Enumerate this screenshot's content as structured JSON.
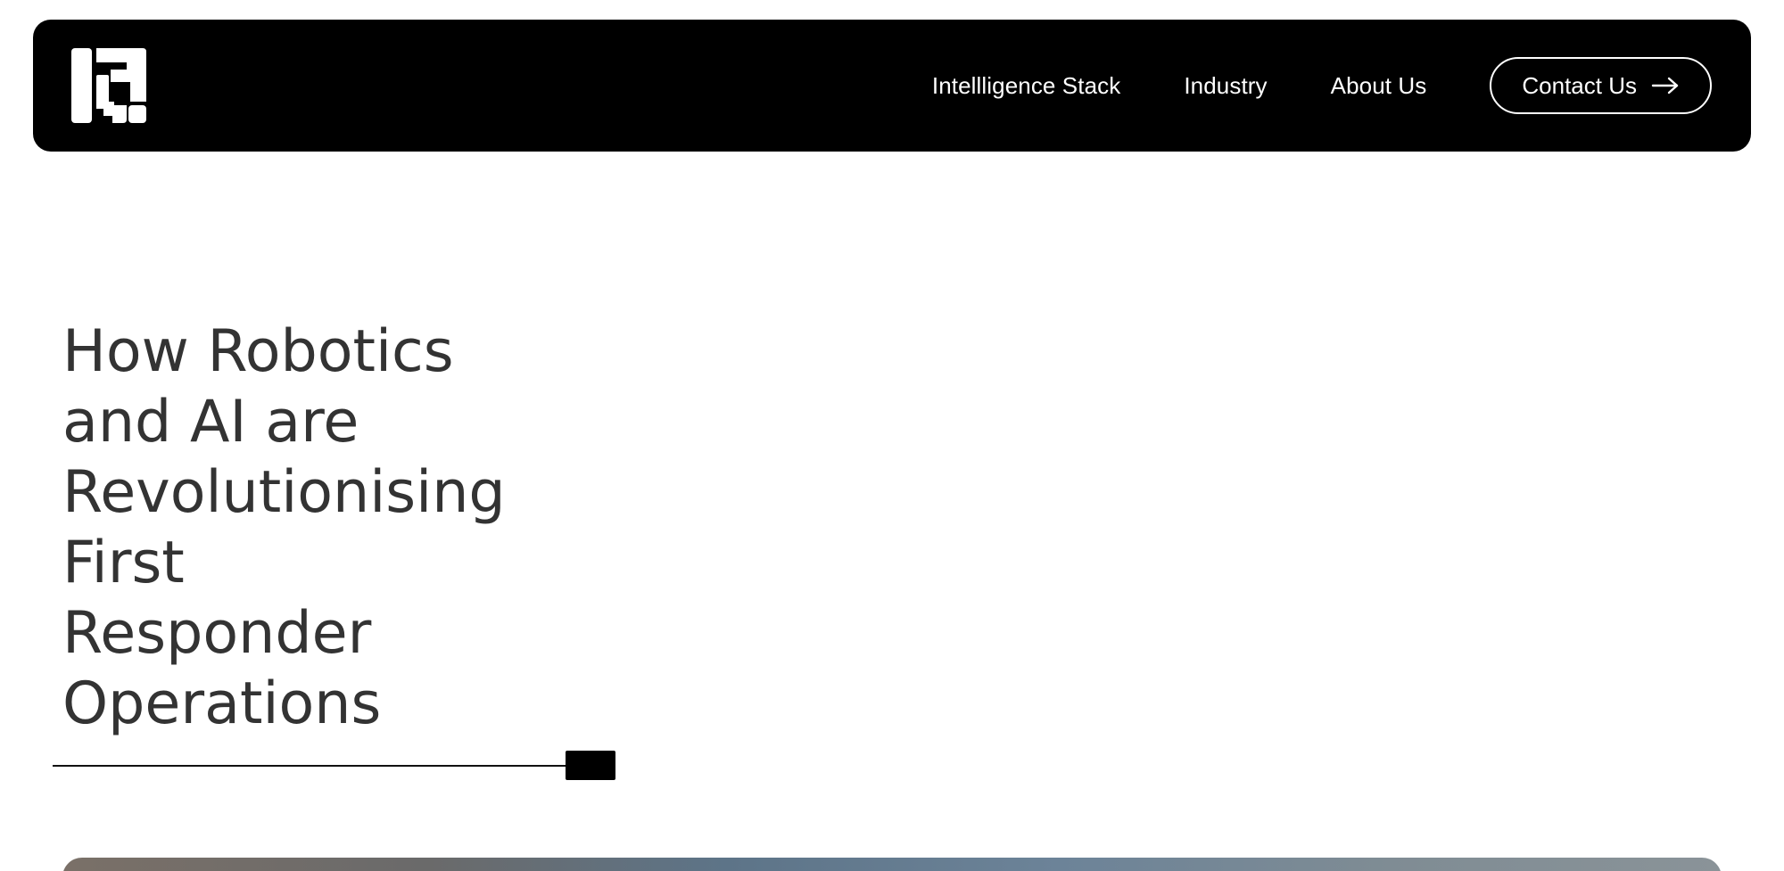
{
  "header": {
    "nav": [
      {
        "label": "Intellligence Stack"
      },
      {
        "label": "Industry"
      },
      {
        "label": "About Us"
      }
    ],
    "contact_label": "Contact Us",
    "logo_icon": "brand-logo-icon",
    "arrow_icon": "arrow-right-icon"
  },
  "hero": {
    "title_lines": [
      "How Robotics",
      "and AI are",
      "Revolutionising",
      "First",
      "Responder",
      "Operations"
    ]
  },
  "colors": {
    "navbar_bg": "#000000",
    "nav_text": "#ffffff",
    "title_text": "#333333",
    "slider_handle": "#000000"
  }
}
